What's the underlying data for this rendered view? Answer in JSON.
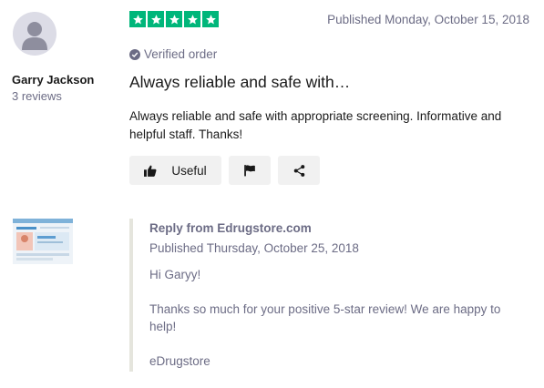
{
  "reviewer": {
    "name": "Garry Jackson",
    "review_count": "3 reviews",
    "avatar_icon": "user-silhouette-icon"
  },
  "review": {
    "rating": 5,
    "rating_max": 5,
    "star_color": "#00b67a",
    "published": "Published Monday, October 15, 2018",
    "verified_label": "Verified order",
    "title": "Always reliable and safe with…",
    "body": "Always reliable and safe with appropriate screening. Informative and helpful staff. Thanks!"
  },
  "actions": {
    "useful_label": "Useful",
    "useful_icon": "thumbs-up-icon",
    "flag_icon": "flag-icon",
    "share_icon": "share-icon"
  },
  "reply": {
    "from": "Reply from Edrugstore.com",
    "published": "Published Thursday, October 25, 2018",
    "greeting": "Hi Garyy!",
    "message": "Thanks so much for your positive 5-star review! We are happy to help!",
    "signature": "eDrugstore"
  }
}
